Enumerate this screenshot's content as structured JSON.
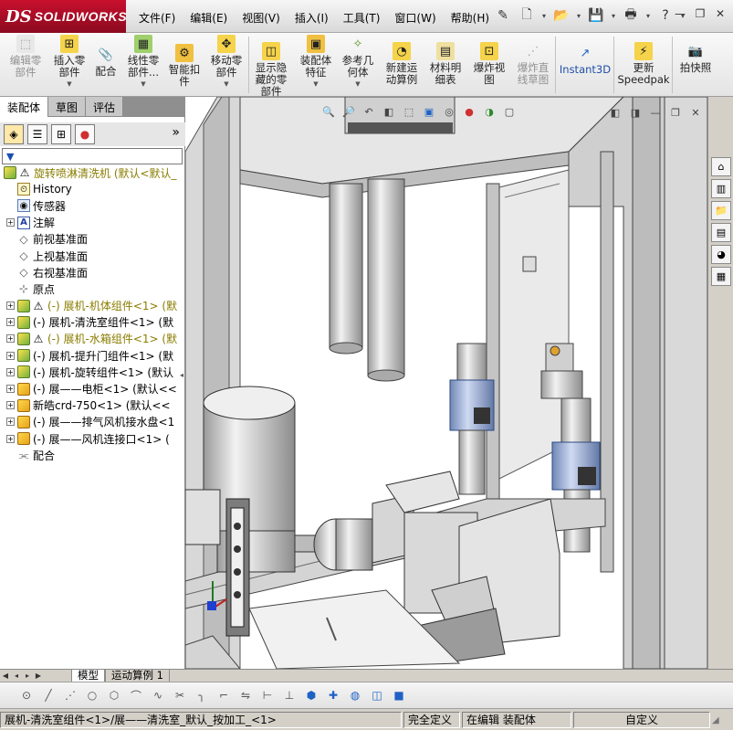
{
  "app": {
    "logo_ds": "DS",
    "logo_name": "SOLIDWORKS"
  },
  "menu": [
    "文件(F)",
    "编辑(E)",
    "视图(V)",
    "插入(I)",
    "工具(T)",
    "窗口(W)",
    "帮助(H)"
  ],
  "commands": [
    {
      "label1": "编辑零",
      "label2": "部件",
      "disabled": true
    },
    {
      "label1": "插入零",
      "label2": "部件",
      "dropdown": true
    },
    {
      "label1": "配合",
      "label2": ""
    },
    {
      "label1": "线性零",
      "label2": "部件...",
      "dropdown": true
    },
    {
      "label1": "智能扣",
      "label2": "件"
    },
    {
      "label1": "移动零",
      "label2": "部件",
      "dropdown": true
    },
    {
      "label1": "显示隐",
      "label2": "藏的零",
      "label3": "部件"
    },
    {
      "label1": "装配体",
      "label2": "特征",
      "dropdown": true
    },
    {
      "label1": "参考几",
      "label2": "何体",
      "dropdown": true
    },
    {
      "label1": "新建运",
      "label2": "动算例"
    },
    {
      "label1": "材料明",
      "label2": "细表"
    },
    {
      "label1": "爆炸视",
      "label2": "图"
    },
    {
      "label1": "爆炸直",
      "label2": "线草图",
      "disabled": true
    },
    {
      "label1": "Instant3D",
      "label2": ""
    },
    {
      "label1": "更新",
      "label2": "Speedpak"
    },
    {
      "label1": "拍快照",
      "label2": ""
    }
  ],
  "left_tabs": [
    "装配体",
    "草图",
    "评估"
  ],
  "filter_label": "▼",
  "tree": {
    "root": "旋转喷淋清洗机  (默认<默认_",
    "items": [
      {
        "text": "History",
        "icon": "hist",
        "exp": false
      },
      {
        "text": "传感器",
        "icon": "sensor",
        "exp": false
      },
      {
        "text": "注解",
        "icon": "note",
        "exp": true
      },
      {
        "text": "前视基准面",
        "icon": "plane",
        "exp": false
      },
      {
        "text": "上视基准面",
        "icon": "plane",
        "exp": false
      },
      {
        "text": "右视基准面",
        "icon": "plane",
        "exp": false
      },
      {
        "text": "原点",
        "icon": "origin",
        "exp": false
      },
      {
        "text": "(-) 展机-机体组件<1> (默",
        "icon": "asm",
        "warn": true,
        "exp": true
      },
      {
        "text": "(-) 展机-清洗室组件<1> (默",
        "icon": "asm",
        "exp": true
      },
      {
        "text": "(-) 展机-水箱组件<1> (默",
        "icon": "asm",
        "warn": true,
        "exp": true
      },
      {
        "text": "(-) 展机-提升门组件<1> (默",
        "icon": "asm",
        "exp": true
      },
      {
        "text": "(-) 展机-旋转组件<1> (默认",
        "icon": "asm",
        "exp": true
      },
      {
        "text": "(-) 展——电柜<1> (默认<<",
        "icon": "part",
        "exp": true
      },
      {
        "text": "新皓crd-750<1> (默认<<",
        "icon": "part",
        "exp": true
      },
      {
        "text": "(-) 展——排气风机接水盘<1",
        "icon": "part",
        "exp": true
      },
      {
        "text": "(-) 展——风机连接口<1> (",
        "icon": "part",
        "exp": true
      },
      {
        "text": "配合",
        "icon": "mate",
        "exp": false
      }
    ]
  },
  "bottom_tabs": [
    "模型",
    "运动算例 1"
  ],
  "status": {
    "path": "展机-清洗室组件<1>/展——清洗室_默认_按加工_<1>",
    "defined": "完全定义",
    "editing": "在编辑 装配体",
    "custom": "自定义"
  },
  "colors": {
    "accent": "#c8102e",
    "panel": "#d4d0c8",
    "frame_gray": "#a9a9a9"
  }
}
